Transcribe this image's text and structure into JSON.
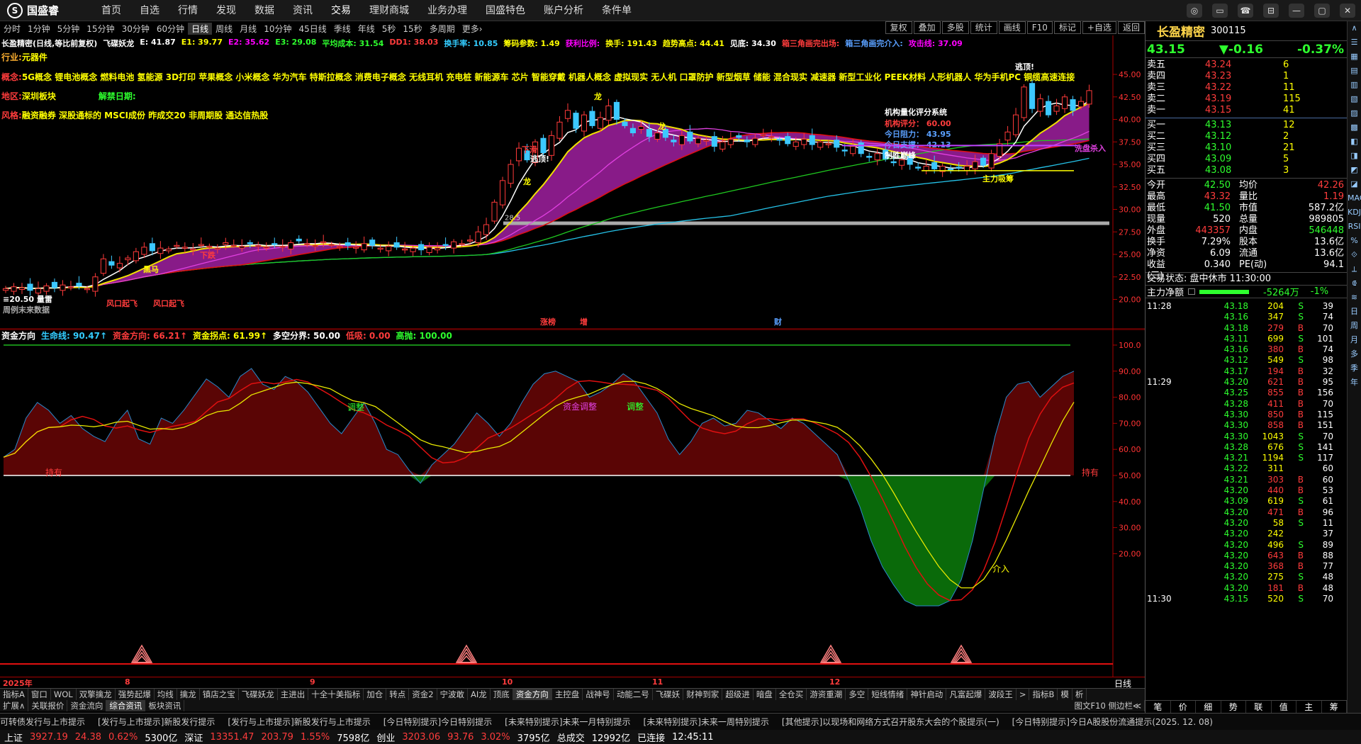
{
  "app": {
    "logo": "国盛睿",
    "menu": [
      "首页",
      "自选",
      "行情",
      "发现",
      "数据",
      "资讯",
      "交易",
      "理财商城",
      "业务办理",
      "国盛特色",
      "账户分析",
      "条件单"
    ],
    "win_buttons": [
      "◎",
      "▭",
      "☎",
      "⊟",
      "—",
      "▢",
      "✕"
    ]
  },
  "periods": [
    "分时",
    "1分钟",
    "5分钟",
    "15分钟",
    "30分钟",
    "60分钟",
    "日线",
    "周线",
    "月线",
    "10分钟",
    "45日线",
    "季线",
    "年线",
    "5秒",
    "15秒",
    "多周期",
    "更多›"
  ],
  "period_selected": "日线",
  "rtoolbar": [
    "复权",
    "叠加",
    "多股",
    "统计",
    "画线",
    "F10",
    "标记",
    "+自选",
    "返回"
  ],
  "maintitle": [
    {
      "t": "长盈精密(日线,等比前复权)",
      "c": "white"
    },
    {
      "t": "飞碟妖龙",
      "c": "white"
    },
    {
      "t": "E: 41.87",
      "c": "white"
    },
    {
      "t": "E1: 39.77",
      "c": "yellow"
    },
    {
      "t": "E2: 35.62",
      "c": "magenta"
    },
    {
      "t": "E3: 29.08",
      "c": "green"
    },
    {
      "t": "平均成本: 31.54",
      "c": "green"
    },
    {
      "t": "DD1: 38.03",
      "c": "red"
    },
    {
      "t": "换手率: 10.85",
      "c": "cyan"
    },
    {
      "t": "筹码参数: 1.49",
      "c": "yellow"
    },
    {
      "t": "获利比例:",
      "c": "magenta"
    },
    {
      "t": "换手: 191.43",
      "c": "yellow"
    },
    {
      "t": "趋势高点: 44.41",
      "c": "yellow"
    },
    {
      "t": "见底: 34.30",
      "c": "white"
    },
    {
      "t": "箱三角画完出场:",
      "c": "red"
    },
    {
      "t": "箱三角画完介入:",
      "c": "blue"
    },
    {
      "t": "攻击线: 37.09",
      "c": "magenta"
    }
  ],
  "info": {
    "industry_label": "行业:",
    "industry": "元器件",
    "concept_label": "概念:",
    "concepts": "5G概念 锂电池概念 燃料电池 氢能源 3D打印 苹果概念 小米概念 华为汽车 特斯拉概念 消费电子概念 无线耳机 充电桩 新能源车 芯片 智能穿戴 机器人概念 虚拟现实 无人机 口罩防护 新型烟草 储能 混合现实 减速器 新型工业化 PEEK材料 人形机器人 华为手机PC 铜缆高速连接",
    "region_label": "地区:",
    "region": "深圳板块",
    "unlock_label": "解禁日期:",
    "style_label": "风格:",
    "style": "融资融券 深股通标的 MSCI成份 昨成交20 非周期股 通达信热股"
  },
  "chart_labels": {
    "rating_title": "机构量化评分系统",
    "rating_score": "机构评分： 60.00",
    "resist": "今日阻力： 43.95",
    "support": "今日支撑： 42.13",
    "win": "制胜巅峰",
    "main_buy": "主力吸筹",
    "wash": "洗盘杀入",
    "lows": "≡20.50 量雷",
    "weekly": "周例末来数据",
    "escape": "逃顶!",
    "dragon": "龙",
    "buy": "买点",
    "black_horse": "黑马",
    "kou": "风口起飞",
    "kou2": "风口起飞",
    "xiaxia": "下跌",
    "xiahua": "下滑",
    "zhangting": "涨榜",
    "zeng": "增",
    "cai": "财"
  },
  "yaxis_main": [
    "45.00",
    "42.50",
    "40.00",
    "37.50",
    "35.00",
    "32.50",
    "30.00",
    "27.50",
    "25.00",
    "22.50",
    "20.00"
  ],
  "yaxis_ind": [
    "100.0",
    "90.00",
    "80.00",
    "70.00",
    "60.00",
    "50.00",
    "40.00",
    "30.00",
    "20.00"
  ],
  "ind_title": [
    {
      "t": "资金方向",
      "c": "white"
    },
    {
      "t": "生命线: 90.47↑",
      "c": "cyan"
    },
    {
      "t": "资金方向: 66.21↑",
      "c": "red"
    },
    {
      "t": "资金拐点: 61.99↑",
      "c": "yellow"
    },
    {
      "t": "多空分界: 50.00",
      "c": "white"
    },
    {
      "t": "低吸: 0.00",
      "c": "red"
    },
    {
      "t": "高抛: 100.00",
      "c": "green"
    }
  ],
  "ind_labels": {
    "tz1": "调整",
    "tz2": "调整",
    "tz3": "调整",
    "zjtz": "资金调整",
    "hold1": "持有",
    "hold2": "持有",
    "jieru": "介入"
  },
  "dates": [
    "2025年",
    "8",
    "9",
    "10",
    "11",
    "12"
  ],
  "datebar_right": "日线",
  "tabs": [
    "指标A",
    "窗口",
    "WOL",
    "双擎擒龙",
    "强势起爆",
    "均线",
    "擒龙",
    "镇店之宝",
    "飞碟妖龙",
    "主进出",
    "十全十美指标",
    "加仓",
    "转点",
    "资金2",
    "宁波敢",
    "AI龙",
    "顶底",
    "资金方向",
    "主控盘",
    "战神号",
    "动能二号",
    "飞碟妖",
    "财神到家",
    "超级进",
    "暗盘",
    "全仓买",
    "游资重潮",
    "多空",
    "短线情绪",
    "神针启动",
    "凡富起爆",
    "波段王",
    ">",
    "指标B",
    "模",
    "析"
  ],
  "tab_selected": "资金方向",
  "tabs2": [
    "扩展∧",
    "关联报价",
    "资金流向",
    "综合资讯",
    "板块资讯"
  ],
  "tabs2_sel": "综合资讯",
  "tabs2_right": "图文F10 侧边栏≪",
  "news": [
    "可转债发行与上市提示",
    "[发行与上市提示]新股发行提示",
    "[发行与上市提示]新股发行与上市提示",
    "[今日特别提示]今日特别提示",
    "[未来特别提示]未来一月特别提示",
    "[未来特别提示]未来一周特别提示",
    "[其他提示]以现场和网络方式召开股东大会的个股提示(一)",
    "[今日特别提示]今日A股股份流通提示(2025. 12. 08)"
  ],
  "status": [
    {
      "t": "上证",
      "c": "white"
    },
    {
      "t": "3927.19",
      "c": "red"
    },
    {
      "t": "24.38",
      "c": "red"
    },
    {
      "t": "0.62%",
      "c": "red"
    },
    {
      "t": "5300亿",
      "c": "white"
    },
    {
      "t": "深证",
      "c": "white"
    },
    {
      "t": "13351.47",
      "c": "red"
    },
    {
      "t": "203.79",
      "c": "red"
    },
    {
      "t": "1.55%",
      "c": "red"
    },
    {
      "t": "7598亿",
      "c": "white"
    },
    {
      "t": "创业",
      "c": "white"
    },
    {
      "t": "3203.06",
      "c": "red"
    },
    {
      "t": "93.76",
      "c": "red"
    },
    {
      "t": "3.02%",
      "c": "red"
    },
    {
      "t": "3795亿",
      "c": "white"
    },
    {
      "t": "总成交",
      "c": "white"
    },
    {
      "t": "12992亿",
      "c": "white"
    },
    {
      "t": "已连接",
      "c": "white"
    },
    {
      "t": "12:45:11",
      "c": "white"
    }
  ],
  "quote": {
    "name": "长盈精密",
    "code": "300115",
    "price": "43.15",
    "change": "▼-0.16",
    "pct": "-0.37%",
    "asks": [
      [
        "卖五",
        "43.24",
        "6"
      ],
      [
        "卖四",
        "43.23",
        "1"
      ],
      [
        "卖三",
        "43.22",
        "11"
      ],
      [
        "卖二",
        "43.19",
        "115"
      ],
      [
        "卖一",
        "43.15",
        "41"
      ]
    ],
    "bids": [
      [
        "买一",
        "43.13",
        "12"
      ],
      [
        "买二",
        "43.12",
        "2"
      ],
      [
        "买三",
        "43.10",
        "21"
      ],
      [
        "买四",
        "43.09",
        "5"
      ],
      [
        "买五",
        "43.08",
        "3"
      ]
    ],
    "stats": [
      [
        "今开",
        "42.50",
        "均价",
        "42.26"
      ],
      [
        "最高",
        "43.32",
        "量比",
        "1.19"
      ],
      [
        "最低",
        "41.50",
        "市值",
        "587.2亿"
      ],
      [
        "现量",
        "520",
        "总量",
        "989805"
      ],
      [
        "外盘",
        "443357",
        "内盘",
        "546448"
      ],
      [
        "换手",
        "7.29%",
        "股本",
        "13.6亿"
      ],
      [
        "净资",
        "6.09",
        "流通",
        "13.6亿"
      ],
      [
        "收益(三)",
        "0.340",
        "PE(动)",
        "94.1"
      ]
    ],
    "trade_state": "交易状态: 盘中休市 11:30:00",
    "mainflow_label": "主力净额",
    "mainflow": "-5264万",
    "mainflow_pct": "-1%"
  },
  "ticks": [
    [
      "11:28",
      "43.18",
      "204",
      "S",
      "39"
    ],
    [
      "",
      "43.16",
      "347",
      "S",
      "74"
    ],
    [
      "",
      "43.18",
      "279",
      "B",
      "70"
    ],
    [
      "",
      "43.11",
      "699",
      "S",
      "101"
    ],
    [
      "",
      "43.16",
      "380",
      "B",
      "74"
    ],
    [
      "",
      "43.12",
      "549",
      "S",
      "98"
    ],
    [
      "",
      "43.17",
      "194",
      "B",
      "32"
    ],
    [
      "11:29",
      "43.20",
      "621",
      "B",
      "95"
    ],
    [
      "",
      "43.25",
      "855",
      "B",
      "156"
    ],
    [
      "",
      "43.28",
      "411",
      "B",
      "70"
    ],
    [
      "",
      "43.30",
      "850",
      "B",
      "115"
    ],
    [
      "",
      "43.30",
      "858",
      "B",
      "151"
    ],
    [
      "",
      "43.30",
      "1043",
      "S",
      "70"
    ],
    [
      "",
      "43.28",
      "676",
      "S",
      "141"
    ],
    [
      "",
      "43.21",
      "1194",
      "S",
      "117"
    ],
    [
      "",
      "43.22",
      "311",
      "",
      "60"
    ],
    [
      "",
      "43.21",
      "303",
      "B",
      "60"
    ],
    [
      "",
      "43.20",
      "440",
      "B",
      "53"
    ],
    [
      "",
      "43.09",
      "619",
      "S",
      "61"
    ],
    [
      "",
      "43.20",
      "471",
      "B",
      "96"
    ],
    [
      "",
      "43.20",
      "58",
      "S",
      "11"
    ],
    [
      "",
      "43.20",
      "242",
      "",
      "37"
    ],
    [
      "",
      "43.20",
      "496",
      "S",
      "89"
    ],
    [
      "",
      "43.20",
      "643",
      "B",
      "88"
    ],
    [
      "",
      "43.20",
      "368",
      "B",
      "77"
    ],
    [
      "",
      "43.20",
      "275",
      "S",
      "48"
    ],
    [
      "",
      "43.20",
      "181",
      "B",
      "48"
    ],
    [
      "11:30",
      "43.15",
      "520",
      "S",
      "70"
    ]
  ],
  "rbottom": [
    "笔",
    "价",
    "细",
    "势",
    "联",
    "值",
    "主",
    "筹"
  ],
  "rside": [
    "∧",
    "☰",
    "▦",
    "▤",
    "▥",
    "▧",
    "▨",
    "▩",
    "◧",
    "◨",
    "◩",
    "◪",
    "MACD",
    "KDJ",
    "RSI",
    "%",
    "⟐",
    "⟂",
    "⟃",
    "≋",
    "日",
    "周",
    "月",
    "多",
    "季",
    "年"
  ]
}
